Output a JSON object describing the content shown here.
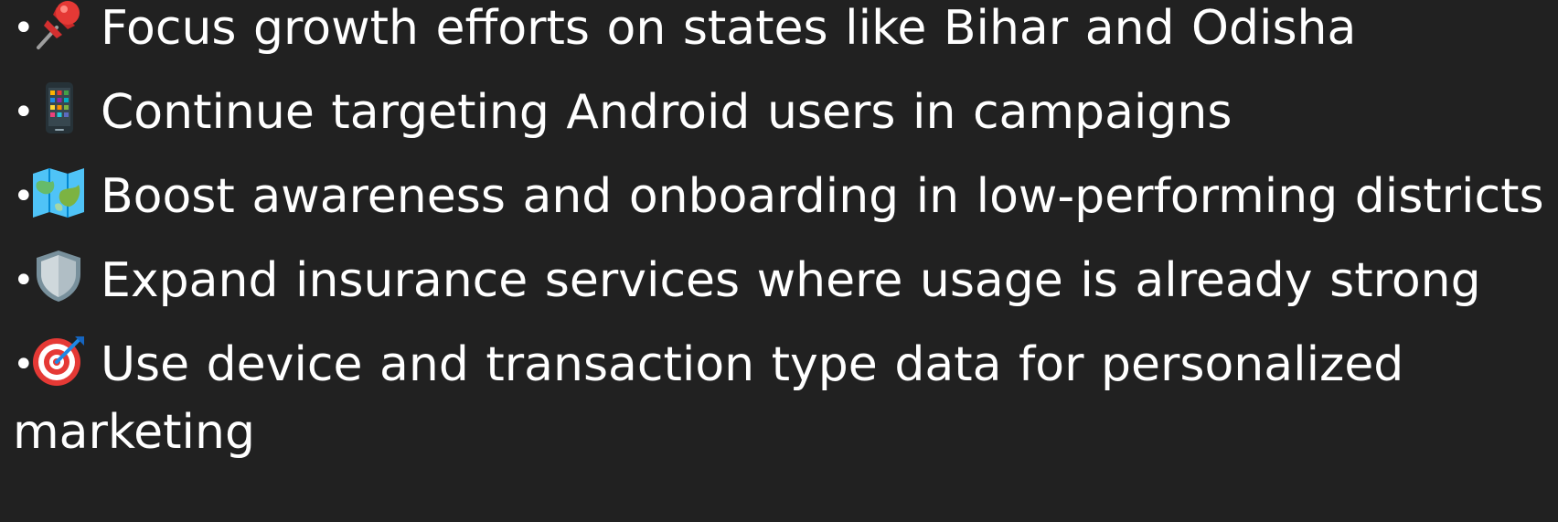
{
  "bullet_glyph": "•",
  "items": [
    {
      "icon": "pushpin-icon",
      "text": "Focus growth efforts on states like Bihar and Odisha"
    },
    {
      "icon": "mobile-phone-icon",
      "text": "Continue targeting Android users in campaigns"
    },
    {
      "icon": "map-icon",
      "text": "Boost awareness and onboarding in low-performing districts"
    },
    {
      "icon": "shield-icon",
      "text": "Expand insurance services where usage is already strong"
    },
    {
      "icon": "target-icon",
      "text": "Use device and transaction type data for personalized marketing"
    }
  ],
  "colors": {
    "background": "#212121",
    "text": "#ffffff"
  }
}
